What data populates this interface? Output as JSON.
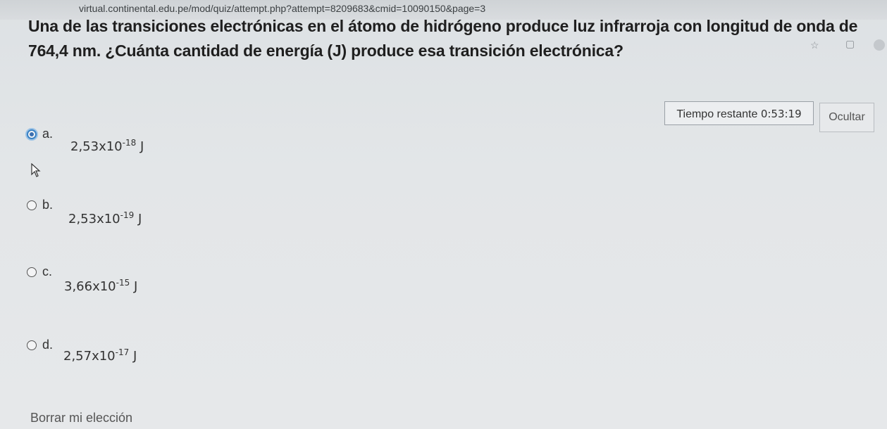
{
  "browser": {
    "url": "virtual.continental.edu.pe/mod/quiz/attempt.php?attempt=8209683&cmid=10090150&page=3"
  },
  "question": {
    "text": "Una de las transiciones electrónicas en el átomo de hidrógeno produce luz infrarroja con longitud de onda de 764,4 nm. ¿Cuánta cantidad de energía (J) produce esa transición electrónica?"
  },
  "timer": {
    "label": "Tiempo restante",
    "value": "0:53:19"
  },
  "hide_button": {
    "label": "Ocultar"
  },
  "options": [
    {
      "letter": "a.",
      "mantissa": "2,53x10",
      "exponent": "-18",
      "unit": "J",
      "selected": true
    },
    {
      "letter": "b.",
      "mantissa": "2,53x10",
      "exponent": "-19",
      "unit": "J",
      "selected": false
    },
    {
      "letter": "c.",
      "mantissa": "3,66x10",
      "exponent": "-15",
      "unit": "J",
      "selected": false
    },
    {
      "letter": "d.",
      "mantissa": "2,57x10",
      "exponent": "-17",
      "unit": "J",
      "selected": false
    }
  ],
  "clear_choice": {
    "label": "Borrar mi elección"
  },
  "icons": [
    "star-icon",
    "tab-icon",
    "profile-icon",
    "radio-icon",
    "pointer-cursor-icon"
  ]
}
